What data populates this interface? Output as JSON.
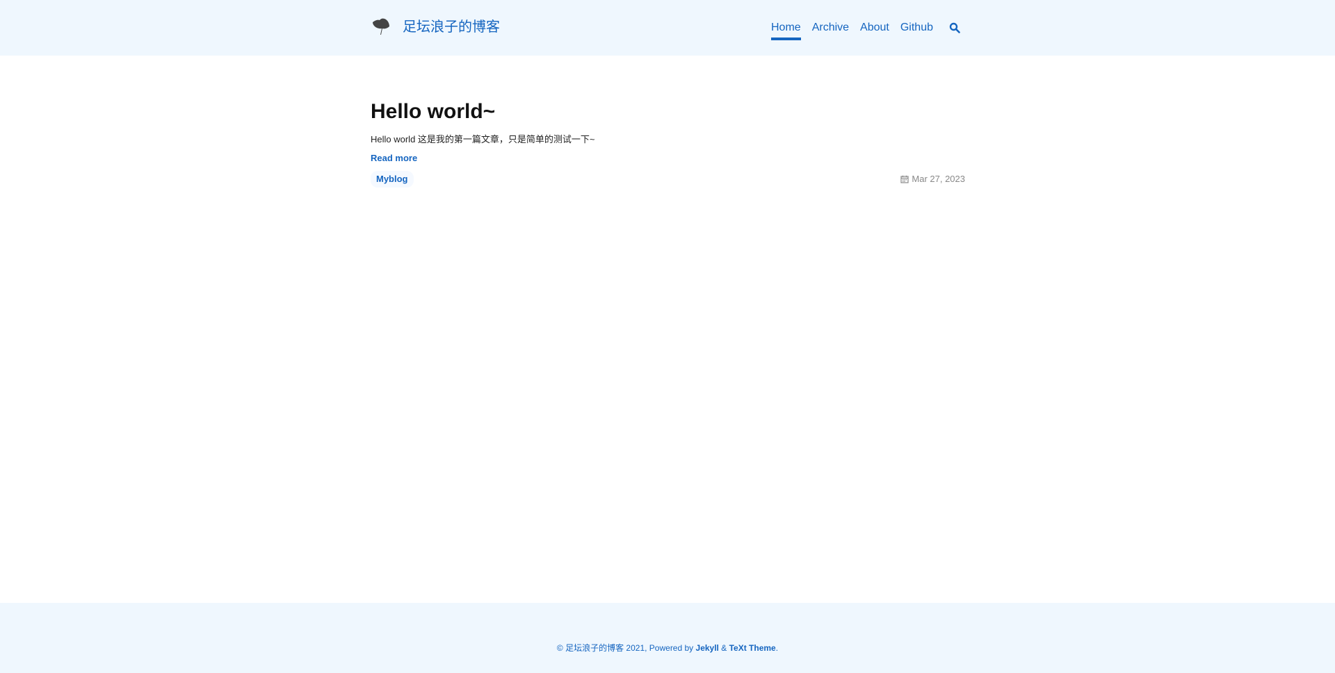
{
  "header": {
    "logo_icon": "ginkgo-leaf-icon",
    "site_title": "足坛浪子的博客",
    "nav": [
      {
        "label": "Home",
        "active": true
      },
      {
        "label": "Archive",
        "active": false
      },
      {
        "label": "About",
        "active": false
      },
      {
        "label": "Github",
        "active": false
      }
    ],
    "search_icon": "search-icon"
  },
  "post": {
    "title": "Hello world~",
    "excerpt": "Hello world 这是我的第一篇文章，只是简单的测试一下~",
    "read_more": "Read more",
    "tag": "Myblog",
    "date_icon": "calendar-icon",
    "date": "Mar 27, 2023"
  },
  "footer": {
    "prefix": "© 足坛浪子的博客 2021, Powered by",
    "jekyll": "Jekyll",
    "amp": "&",
    "theme": "TeXt Theme",
    "suffix": "."
  },
  "colors": {
    "accent": "#1565c0",
    "header_bg": "#eff7fe",
    "footer_bg": "#eff7fe",
    "title_text": "#111111",
    "meta_text": "#888888"
  }
}
